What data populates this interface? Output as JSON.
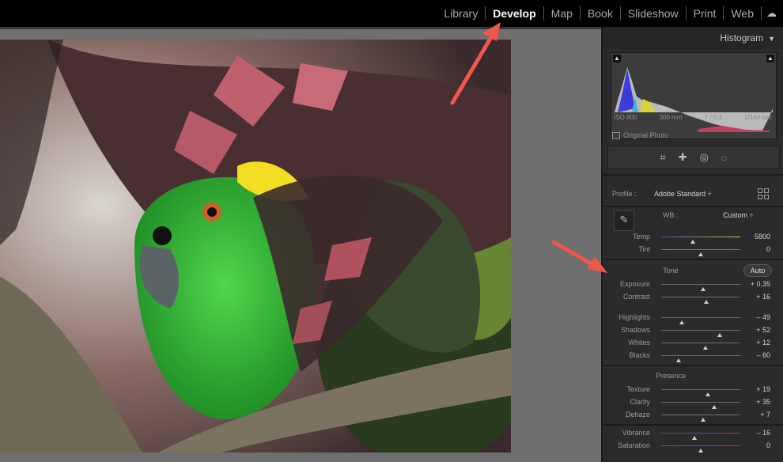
{
  "modules": [
    {
      "label": "Library",
      "active": false
    },
    {
      "label": "Develop",
      "active": true
    },
    {
      "label": "Map",
      "active": false
    },
    {
      "label": "Book",
      "active": false
    },
    {
      "label": "Slideshow",
      "active": false
    },
    {
      "label": "Print",
      "active": false
    },
    {
      "label": "Web",
      "active": false
    }
  ],
  "histogram": {
    "title": "Histogram",
    "exif": [
      "ISO 800",
      "300 mm",
      "ƒ / 6.3",
      "1/160 sec"
    ],
    "original_photo": "Original Photo"
  },
  "basic": {
    "profile_label": "Profile :",
    "profile_value": "Adobe Standard ÷",
    "wb_label": "WB :",
    "wb_value": "Custom ÷",
    "tone_title": "Tone",
    "auto_label": "Auto",
    "presence_title": "Presence",
    "sliders": [
      {
        "label": "Temp",
        "value": "5800",
        "pos": 0.4
      },
      {
        "label": "Tint",
        "value": "0",
        "pos": 0.5
      },
      {
        "label": "Exposure",
        "value": "+ 0.35",
        "pos": 0.53
      },
      {
        "label": "Contrast",
        "value": "+ 16",
        "pos": 0.57
      },
      {
        "label": "Highlights",
        "value": "– 49",
        "pos": 0.26
      },
      {
        "label": "Shadows",
        "value": "+ 52",
        "pos": 0.74
      },
      {
        "label": "Whites",
        "value": "+ 12",
        "pos": 0.56
      },
      {
        "label": "Blacks",
        "value": "– 60",
        "pos": 0.22
      },
      {
        "label": "Texture",
        "value": "+ 19",
        "pos": 0.59
      },
      {
        "label": "Clarity",
        "value": "+ 35",
        "pos": 0.67
      },
      {
        "label": "Dehaze",
        "value": "+ 7",
        "pos": 0.53
      },
      {
        "label": "Vibrance",
        "value": "– 16",
        "pos": 0.42
      },
      {
        "label": "Saturation",
        "value": "0",
        "pos": 0.5
      }
    ]
  },
  "icons": [
    "crop-icon",
    "heal-icon",
    "redeye-icon",
    "mask-icon",
    "eyedropper-icon",
    "cloud-icon"
  ],
  "colors": {
    "accent_arrow": "#f0574a"
  }
}
